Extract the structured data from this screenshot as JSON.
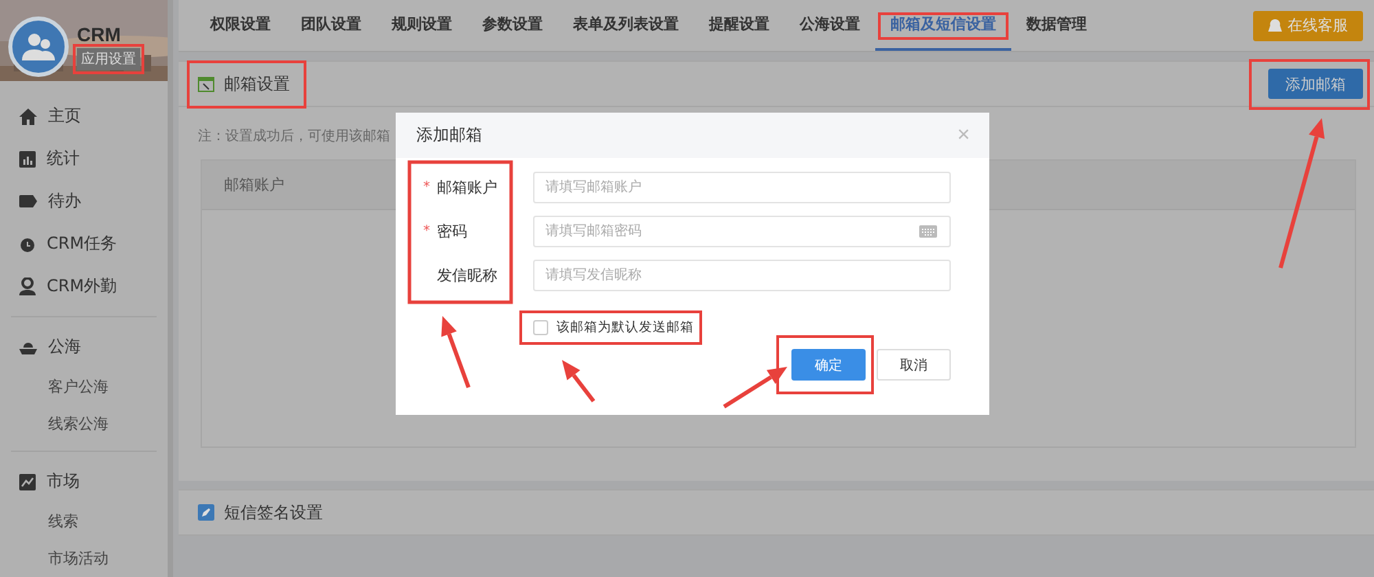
{
  "app": {
    "name": "CRM",
    "subtitle": "应用设置"
  },
  "sidebar": {
    "items": [
      {
        "label": "主页"
      },
      {
        "label": "统计"
      },
      {
        "label": "待办"
      },
      {
        "label": "CRM任务"
      },
      {
        "label": "CRM外勤"
      },
      {
        "label": "公海",
        "children": [
          {
            "label": "客户公海"
          },
          {
            "label": "线索公海"
          }
        ]
      },
      {
        "label": "市场",
        "children": [
          {
            "label": "线索"
          },
          {
            "label": "市场活动"
          }
        ]
      }
    ]
  },
  "tabs": [
    {
      "label": "权限设置",
      "selected": false
    },
    {
      "label": "团队设置",
      "selected": false
    },
    {
      "label": "规则设置",
      "selected": false
    },
    {
      "label": "参数设置",
      "selected": false
    },
    {
      "label": "表单及列表设置",
      "selected": false
    },
    {
      "label": "提醒设置",
      "selected": false
    },
    {
      "label": "公海设置",
      "selected": false
    },
    {
      "label": "邮箱及短信设置",
      "selected": true
    },
    {
      "label": "数据管理",
      "selected": false
    }
  ],
  "support_button": "在线客服",
  "email_section": {
    "title": "邮箱设置",
    "add_button": "添加邮箱",
    "note": "注：设置成功后，可使用该邮箱",
    "table": {
      "columns": [
        "邮箱账户"
      ]
    }
  },
  "sms_section": {
    "title": "短信签名设置"
  },
  "dialog": {
    "title": "添加邮箱",
    "close": "×",
    "required_mark": "*",
    "fields": [
      {
        "label": "邮箱账户",
        "required": true,
        "placeholder": "请填写邮箱账户"
      },
      {
        "label": "密码",
        "required": true,
        "placeholder": "请填写邮箱密码",
        "keyboard": true
      },
      {
        "label": "发信昵称",
        "required": false,
        "placeholder": "请填写发信昵称"
      }
    ],
    "checkbox": {
      "label": "该邮箱为默认发送邮箱",
      "checked": false
    },
    "buttons": [
      {
        "label": "确定",
        "kind": "primary"
      },
      {
        "label": "取消",
        "kind": "secondary"
      }
    ]
  }
}
